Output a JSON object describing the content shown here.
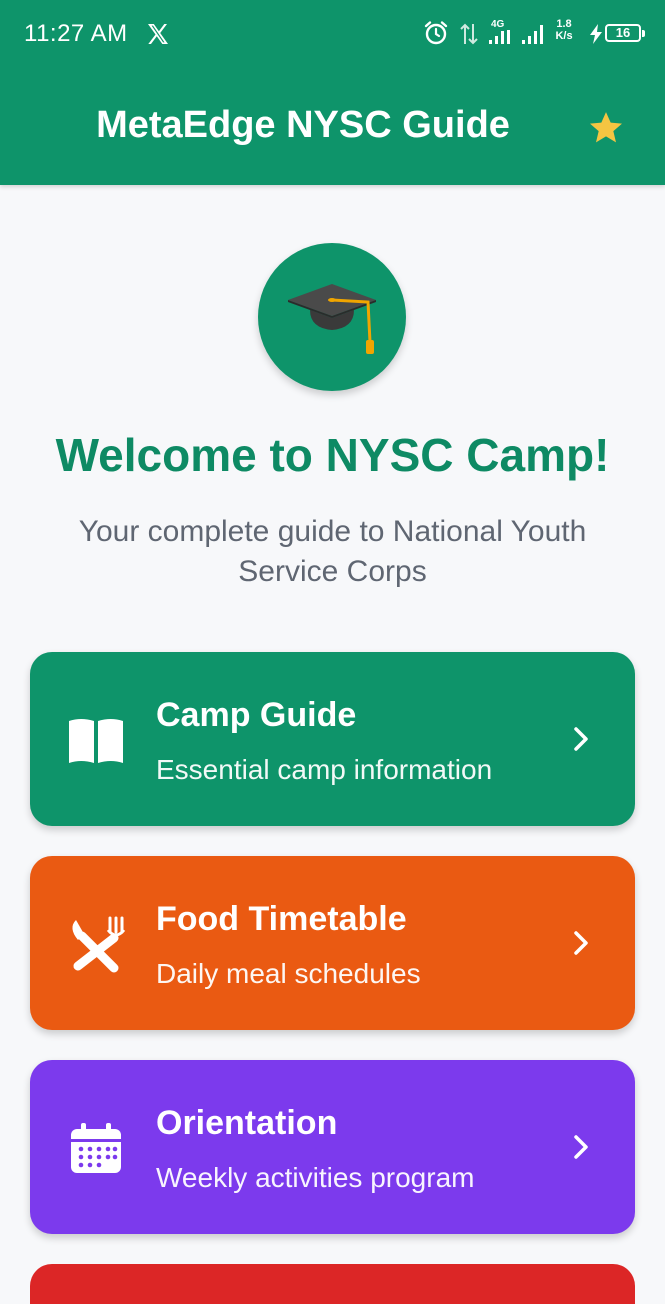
{
  "status_bar": {
    "time": "11:27 AM",
    "net_speed_value": "1.8",
    "net_speed_unit": "K/s",
    "battery": "16",
    "network_label": "4G"
  },
  "app_bar": {
    "title": "MetaEdge NYSC Guide",
    "star_color": "#f5c542",
    "background": "#0e946a"
  },
  "hero": {
    "logo_icon": "graduation-cap-icon",
    "welcome": "Welcome to NYSC Camp!",
    "subtitle": "Your complete guide to National Youth Service Corps"
  },
  "cards": [
    {
      "title": "Camp Guide",
      "description": "Essential camp information",
      "icon": "book-icon",
      "color": "#0e946a"
    },
    {
      "title": "Food Timetable",
      "description": "Daily meal schedules",
      "icon": "utensils-icon",
      "color": "#ea5a12"
    },
    {
      "title": "Orientation",
      "description": "Weekly activities program",
      "icon": "calendar-icon",
      "color": "#7c3aed"
    }
  ],
  "next_card_color": "#dc2626"
}
